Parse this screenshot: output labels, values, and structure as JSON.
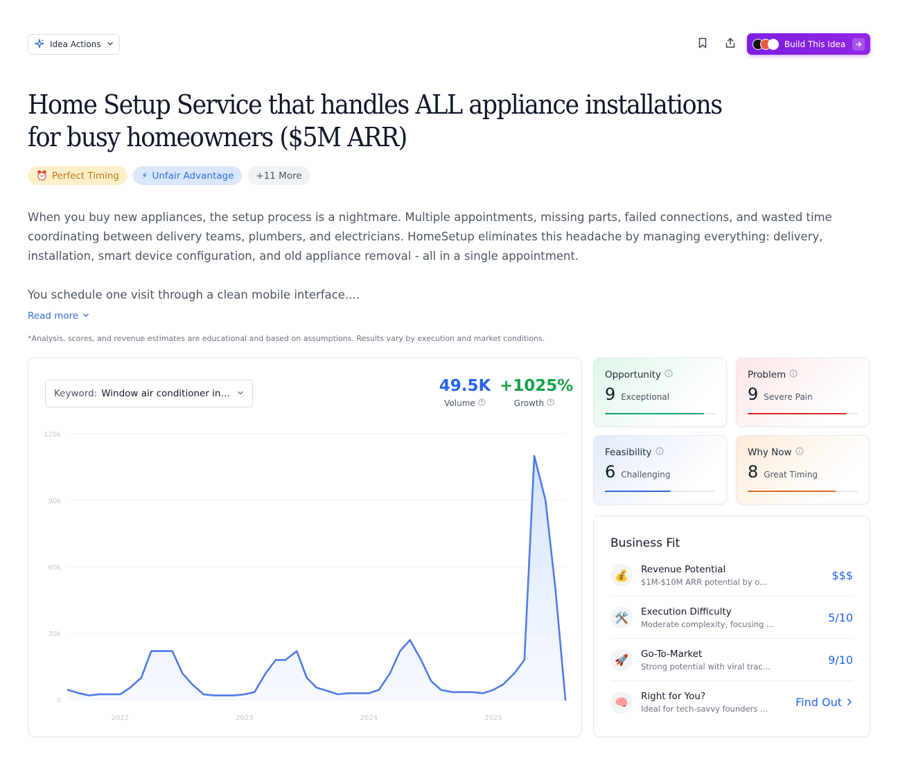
{
  "toolbar": {
    "idea_actions_label": "Idea Actions",
    "build_label": "Build This Idea"
  },
  "idea": {
    "title": "Home Setup Service that handles ALL appliance installations for busy homeowners ($5M ARR)",
    "tags": [
      "Perfect Timing",
      "Unfair Advantage",
      "+11 More"
    ],
    "description": [
      "When you buy new appliances, the setup process is a nightmare. Multiple appointments, missing parts, failed connections, and wasted time coordinating between delivery teams, plumbers, and electricians. HomeSetup eliminates this headache by managing everything: delivery, installation, smart device configuration, and old appliance removal - all in a single appointment.",
      "You schedule one visit through a clean mobile interface...."
    ],
    "read_more": "Read more",
    "disclaimer": "*Analysis, scores, and revenue estimates are educational and based on assumptions. Results vary by execution and market conditions."
  },
  "keyword": {
    "label": "Keyword:",
    "value": "Window air conditioner installation"
  },
  "metrics": {
    "volume": "49.5K",
    "volume_label": "Volume",
    "growth": "+1025%",
    "growth_label": "Growth"
  },
  "chart_data": {
    "type": "area",
    "title": "",
    "xlabel": "",
    "ylabel": "",
    "ylim": [
      0,
      120000
    ],
    "yticks": [
      "0",
      "30k",
      "60k",
      "90k",
      "120k"
    ],
    "ytick_values": [
      0,
      30000,
      60000,
      90000,
      120000
    ],
    "xticks": [
      "2022",
      "2023",
      "2024",
      "2025"
    ],
    "xtick_values": [
      2022.0,
      2023.0,
      2024.0,
      2025.0
    ],
    "grid": true,
    "color": "#4f7ae6",
    "x": [
      2021.58,
      2021.67,
      2021.75,
      2021.83,
      2021.92,
      2022.0,
      2022.08,
      2022.17,
      2022.25,
      2022.33,
      2022.42,
      2022.5,
      2022.58,
      2022.67,
      2022.75,
      2022.83,
      2022.92,
      2023.0,
      2023.08,
      2023.17,
      2023.25,
      2023.33,
      2023.42,
      2023.5,
      2023.58,
      2023.67,
      2023.75,
      2023.83,
      2023.92,
      2024.0,
      2024.08,
      2024.17,
      2024.25,
      2024.33,
      2024.42,
      2024.5,
      2024.58,
      2024.67,
      2024.75,
      2024.83,
      2024.92,
      2025.0,
      2025.08,
      2025.17,
      2025.25,
      2025.33,
      2025.42,
      2025.5,
      2025.58
    ],
    "values": [
      4500,
      3000,
      2000,
      2500,
      2500,
      2500,
      5500,
      10000,
      22000,
      22000,
      22000,
      12000,
      7000,
      2500,
      2000,
      2000,
      2000,
      2500,
      3500,
      12000,
      18000,
      18000,
      22000,
      10000,
      5500,
      4000,
      2500,
      3000,
      3000,
      3000,
      4500,
      12000,
      22000,
      27000,
      18000,
      8500,
      4500,
      3500,
      3500,
      3500,
      3000,
      4500,
      7000,
      12000,
      18000,
      110000,
      90000,
      50000,
      0
    ]
  },
  "scores": [
    {
      "name": "Opportunity",
      "value": "9",
      "word": "Exceptional",
      "fraction": 0.9,
      "color": "#10a37f"
    },
    {
      "name": "Problem",
      "value": "9",
      "word": "Severe Pain",
      "fraction": 0.9,
      "color": "#dc2626"
    },
    {
      "name": "Feasibility",
      "value": "6",
      "word": "Challenging",
      "fraction": 0.6,
      "color": "#2f6bd8"
    },
    {
      "name": "Why Now",
      "value": "8",
      "word": "Great Timing",
      "fraction": 0.8,
      "color": "#dd6b20"
    }
  ],
  "business_fit": {
    "title": "Business Fit",
    "rows": [
      {
        "icon": "money-bag-icon",
        "glyph": "💰",
        "title": "Revenue Potential",
        "sub": "$1M-$10M ARR potential by o...",
        "value": "$$$"
      },
      {
        "icon": "tools-icon",
        "glyph": "🛠️",
        "title": "Execution Difficulty",
        "sub": "Moderate complexity, focusing ...",
        "value": "5/10"
      },
      {
        "icon": "rocket-icon",
        "glyph": "🚀",
        "title": "Go-To-Market",
        "sub": "Strong potential with viral trac...",
        "value": "9/10"
      },
      {
        "icon": "brain-icon",
        "glyph": "🧠",
        "title": "Right for You?",
        "sub": "Ideal for tech-savvy founders ...",
        "value": "Find Out"
      }
    ]
  }
}
